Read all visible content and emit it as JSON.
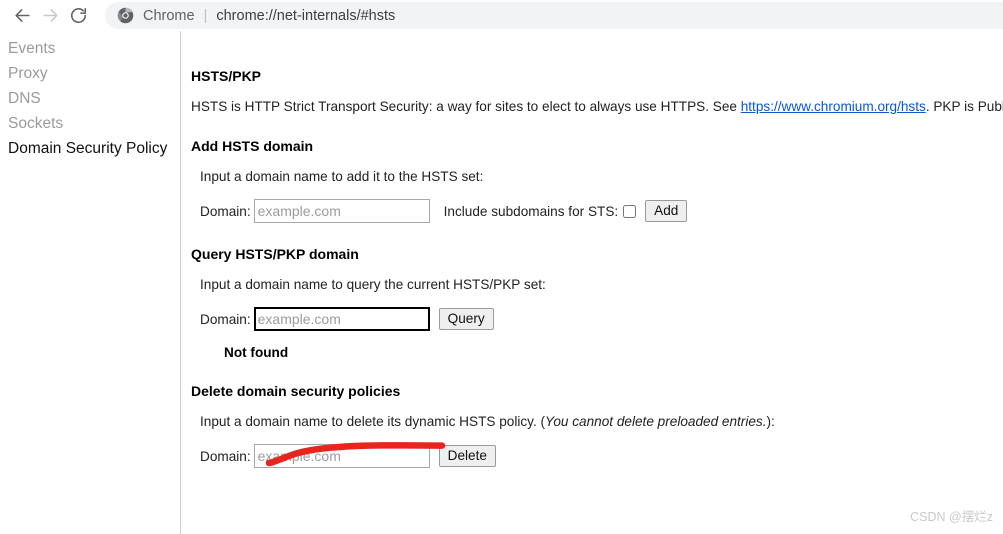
{
  "browser": {
    "back_icon": "back-arrow-icon",
    "forward_icon": "forward-arrow-icon",
    "reload_icon": "reload-icon",
    "chrome_icon": "chrome-logo-icon",
    "scheme_label": "Chrome",
    "separator": "|",
    "url": "chrome://net-internals/#hsts"
  },
  "sidebar": {
    "items": [
      {
        "label": "Events",
        "active": false
      },
      {
        "label": "Proxy",
        "active": false
      },
      {
        "label": "DNS",
        "active": false
      },
      {
        "label": "Sockets",
        "active": false
      },
      {
        "label": "Domain Security Policy",
        "active": true
      }
    ]
  },
  "main": {
    "title": "HSTS/PKP",
    "intro_before": "HSTS is HTTP Strict Transport Security: a way for sites to elect to always use HTTPS. See ",
    "intro_link": "https://www.chromium.org/hsts",
    "intro_after": ". PKP is Public Key Pinning: Chrome",
    "add": {
      "heading": "Add HSTS domain",
      "description": "Input a domain name to add it to the HSTS set:",
      "domain_label": "Domain:",
      "domain_value": "",
      "domain_placeholder": "example.com",
      "subdomains_label": "Include subdomains for STS:",
      "subdomains_checked": false,
      "button_label": "Add"
    },
    "query": {
      "heading": "Query HSTS/PKP domain",
      "description": "Input a domain name to query the current HSTS/PKP set:",
      "domain_label": "Domain:",
      "domain_value": "",
      "domain_placeholder": "example.com",
      "button_label": "Query",
      "result": "Not found"
    },
    "delete": {
      "heading": "Delete domain security policies",
      "description_before": "Input a domain name to delete its dynamic HSTS policy. (",
      "description_italic": "You cannot delete preloaded entries.",
      "description_after": "):",
      "domain_label": "Domain:",
      "domain_value": "",
      "domain_placeholder": "example.com",
      "button_label": "Delete"
    }
  },
  "annotation": {
    "name": "red-underline-stroke",
    "color": "#e8241f"
  },
  "watermark": {
    "text": "CSDN @摆烂z"
  }
}
